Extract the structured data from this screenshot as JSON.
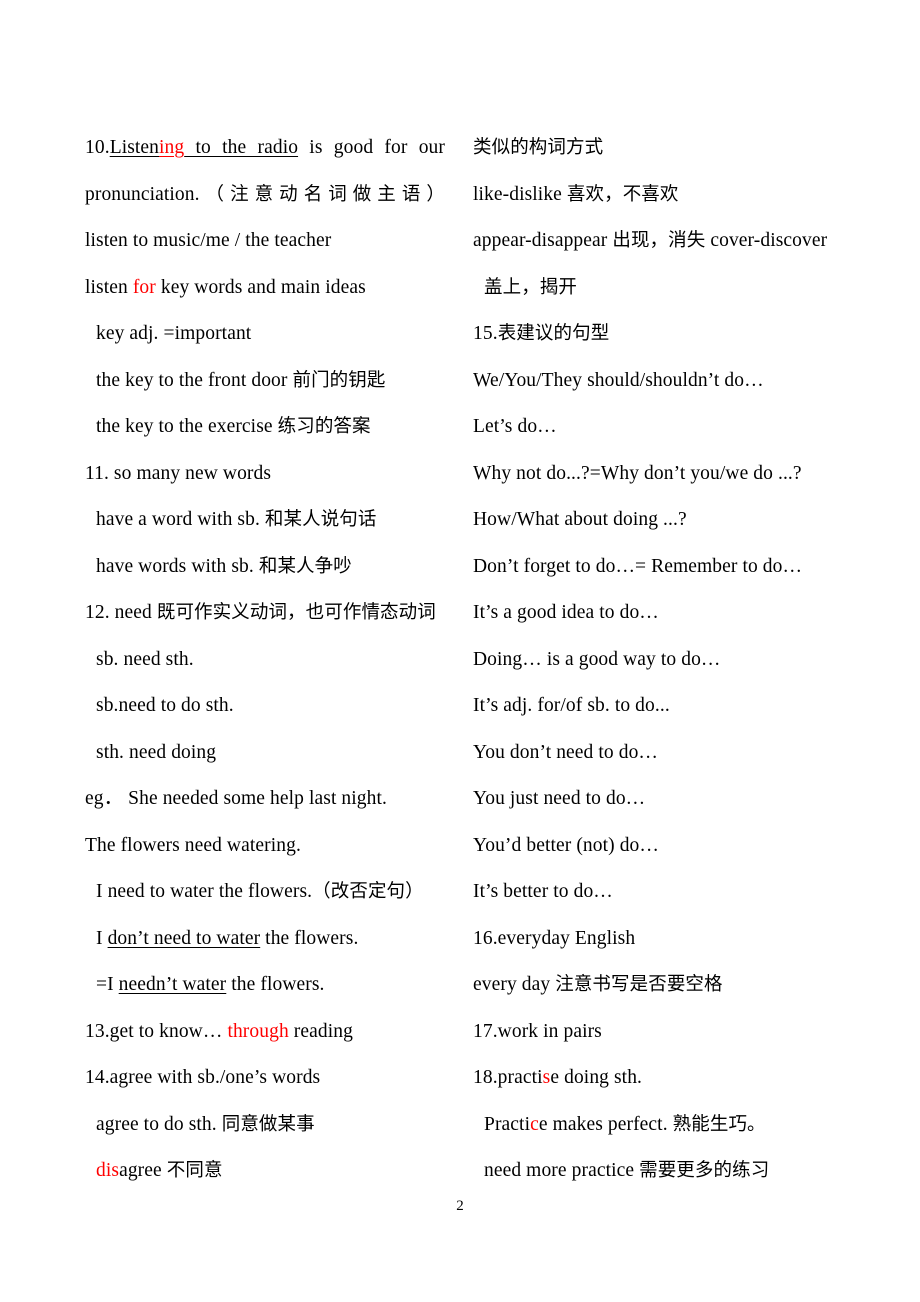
{
  "document": {
    "page_number": "2",
    "accent_color": "#ff0000",
    "text_color": "#000000",
    "background_color": "#ffffff"
  },
  "left_column": {
    "lines": [
      {
        "id": "l1",
        "justified": true,
        "segments": [
          {
            "text": "10.",
            "style": "plain"
          },
          {
            "text": "Listen",
            "style": "underline"
          },
          {
            "text": "ing",
            "style": "underline-red"
          },
          {
            "text": " to the radio",
            "style": "underline"
          },
          {
            "text": " is good for our",
            "style": "plain"
          }
        ],
        "plain_text": "10.Listening to the radio is good for our"
      },
      {
        "id": "l2",
        "justified": true,
        "segments": [
          {
            "text": "pronunciation.",
            "style": "plain"
          },
          {
            "text": "（注意动名词做主语）",
            "style": "cjk"
          }
        ],
        "plain_text": "pronunciation. （注意动名词做主语）"
      },
      {
        "id": "l3",
        "indent": 0,
        "segments": [
          {
            "text": "listen to music/me / the teacher",
            "style": "plain"
          }
        ],
        "plain_text": "listen to music/me / the teacher"
      },
      {
        "id": "l4",
        "indent": 0,
        "segments": [
          {
            "text": "listen ",
            "style": "plain"
          },
          {
            "text": "for",
            "style": "red"
          },
          {
            "text": " key words and main ideas",
            "style": "plain"
          }
        ],
        "plain_text": "listen for key words and main ideas"
      },
      {
        "id": "l5",
        "indent": 1,
        "segments": [
          {
            "text": "key adj.   =important",
            "style": "plain"
          }
        ],
        "plain_text": "key adj.   =important"
      },
      {
        "id": "l6",
        "indent": 1,
        "segments": [
          {
            "text": "the key to the front door ",
            "style": "plain"
          },
          {
            "text": "前门的钥匙",
            "style": "cjk"
          }
        ],
        "plain_text": "the key to the front door 前门的钥匙"
      },
      {
        "id": "l7",
        "indent": 1,
        "segments": [
          {
            "text": "the key to the exercise ",
            "style": "plain"
          },
          {
            "text": "练习的答案",
            "style": "cjk"
          }
        ],
        "plain_text": "the key to the exercise 练习的答案"
      },
      {
        "id": "l8",
        "indent": 0,
        "segments": [
          {
            "text": "11. so many new words",
            "style": "plain"
          }
        ],
        "plain_text": "11. so many new words"
      },
      {
        "id": "l9",
        "indent": 1,
        "segments": [
          {
            "text": "have a word with sb. ",
            "style": "plain"
          },
          {
            "text": "和某人说句话",
            "style": "cjk"
          }
        ],
        "plain_text": "have a word with sb. 和某人说句话"
      },
      {
        "id": "l10",
        "indent": 1,
        "segments": [
          {
            "text": "have words with sb. ",
            "style": "plain"
          },
          {
            "text": "和某人争吵",
            "style": "cjk"
          }
        ],
        "plain_text": "have words with sb. 和某人争吵"
      },
      {
        "id": "l11",
        "indent": 0,
        "segments": [
          {
            "text": "12. need ",
            "style": "plain"
          },
          {
            "text": "既可作实义动词，也可作情态动词",
            "style": "cjk"
          }
        ],
        "plain_text": "12. need 既可作实义动词，也可作情态动词"
      },
      {
        "id": "l12",
        "indent": 1,
        "segments": [
          {
            "text": "sb. need sth.",
            "style": "plain"
          }
        ],
        "plain_text": "sb. need sth."
      },
      {
        "id": "l13",
        "indent": 1,
        "segments": [
          {
            "text": "sb.need to do sth.",
            "style": "plain"
          }
        ],
        "plain_text": "sb.need to do sth."
      },
      {
        "id": "l14",
        "indent": 1,
        "segments": [
          {
            "text": "sth. need doing",
            "style": "plain"
          }
        ],
        "plain_text": "sth. need doing"
      },
      {
        "id": "l15",
        "indent": 0,
        "segments": [
          {
            "text": "eg．  She needed some help last night.",
            "style": "plain"
          }
        ],
        "plain_text": "eg．  She needed some help last night."
      },
      {
        "id": "l16",
        "indent": 0,
        "segments": [
          {
            "text": "The flowers need watering.",
            "style": "plain"
          }
        ],
        "plain_text": "The flowers need watering."
      },
      {
        "id": "l17",
        "indent": 1,
        "segments": [
          {
            "text": "I need to water the flowers.",
            "style": "plain"
          },
          {
            "text": "（改否定句）",
            "style": "cjk"
          }
        ],
        "plain_text": "I need to water the flowers.（改否定句）"
      },
      {
        "id": "l18",
        "indent": 1,
        "segments": [
          {
            "text": "I ",
            "style": "plain"
          },
          {
            "text": "don’t need to water",
            "style": "underline"
          },
          {
            "text": " the flowers.",
            "style": "plain"
          }
        ],
        "plain_text": "I don’t need to water the flowers."
      },
      {
        "id": "l19",
        "indent": 1,
        "segments": [
          {
            "text": "=I ",
            "style": "plain"
          },
          {
            "text": "needn’t water",
            "style": "underline"
          },
          {
            "text": " the flowers.",
            "style": "plain"
          }
        ],
        "plain_text": "=I needn’t water the flowers."
      },
      {
        "id": "l20",
        "indent": 0,
        "segments": [
          {
            "text": "13.get to know… ",
            "style": "plain"
          },
          {
            "text": "through",
            "style": "red"
          },
          {
            "text": " reading",
            "style": "plain"
          }
        ],
        "plain_text": "13.get to know… through reading"
      },
      {
        "id": "l21",
        "indent": 0,
        "segments": [
          {
            "text": "14.agree with sb./one’s words",
            "style": "plain"
          }
        ],
        "plain_text": "14.agree with sb./one’s words"
      },
      {
        "id": "l22",
        "indent": 1,
        "segments": [
          {
            "text": "agree to do sth. ",
            "style": "plain"
          },
          {
            "text": "同意做某事",
            "style": "cjk"
          }
        ],
        "plain_text": "agree to do sth. 同意做某事"
      },
      {
        "id": "l23",
        "indent": 1,
        "segments": [
          {
            "text": "dis",
            "style": "red"
          },
          {
            "text": "agree ",
            "style": "plain"
          },
          {
            "text": "不同意",
            "style": "cjk"
          }
        ],
        "plain_text": "disagree 不同意"
      }
    ]
  },
  "right_column": {
    "lines": [
      {
        "id": "r1",
        "indent": 0,
        "segments": [
          {
            "text": "类似的构词方式",
            "style": "cjk"
          }
        ],
        "plain_text": "类似的构词方式"
      },
      {
        "id": "r2",
        "indent": 0,
        "segments": [
          {
            "text": "like-dislike  ",
            "style": "plain"
          },
          {
            "text": "喜欢，不喜欢",
            "style": "cjk"
          }
        ],
        "plain_text": "like-dislike 喜欢，不喜欢"
      },
      {
        "id": "r3",
        "indent": 0,
        "segments": [
          {
            "text": "appear-disappear ",
            "style": "plain"
          },
          {
            "text": "出现，消失",
            "style": "cjk"
          },
          {
            "text": "  cover-discover",
            "style": "plain"
          }
        ],
        "plain_text": "appear-disappear 出现，消失  cover-discover"
      },
      {
        "id": "r4",
        "indent": 1,
        "segments": [
          {
            "text": "盖上，揭开",
            "style": "cjk"
          }
        ],
        "plain_text": "盖上，揭开"
      },
      {
        "id": "r5",
        "indent": 0,
        "segments": [
          {
            "text": "15.",
            "style": "plain"
          },
          {
            "text": "表建议的句型",
            "style": "cjk"
          }
        ],
        "plain_text": "15.表建议的句型"
      },
      {
        "id": "r6",
        "indent": 0,
        "segments": [
          {
            "text": "We/You/They should/shouldn’t do…",
            "style": "plain"
          }
        ],
        "plain_text": "We/You/They should/shouldn’t do…"
      },
      {
        "id": "r7",
        "indent": 0,
        "segments": [
          {
            "text": "Let’s do…",
            "style": "plain"
          }
        ],
        "plain_text": "Let’s do…"
      },
      {
        "id": "r8",
        "indent": 0,
        "segments": [
          {
            "text": "Why not do...?=Why don’t you/we do ...?",
            "style": "plain"
          }
        ],
        "plain_text": "Why not do...?=Why don’t you/we do ...?"
      },
      {
        "id": "r9",
        "indent": 0,
        "segments": [
          {
            "text": "How/What about doing ...?",
            "style": "plain"
          }
        ],
        "plain_text": "How/What about doing ...?"
      },
      {
        "id": "r10",
        "indent": 0,
        "segments": [
          {
            "text": "Don’t forget to do…= Remember to do…",
            "style": "plain"
          }
        ],
        "plain_text": "Don’t forget to do…= Remember to do…"
      },
      {
        "id": "r11",
        "indent": 0,
        "segments": [
          {
            "text": "It’s a good idea to do…",
            "style": "plain"
          }
        ],
        "plain_text": "It’s a good idea to do…"
      },
      {
        "id": "r12",
        "indent": 0,
        "segments": [
          {
            "text": "Doing… is a good way to do…",
            "style": "plain"
          }
        ],
        "plain_text": "Doing… is a good way to do…"
      },
      {
        "id": "r13",
        "indent": 0,
        "segments": [
          {
            "text": "It’s adj. for/of sb. to do...",
            "style": "plain"
          }
        ],
        "plain_text": "It’s adj. for/of sb. to do..."
      },
      {
        "id": "r14",
        "indent": 0,
        "segments": [
          {
            "text": "You don’t need to do…",
            "style": "plain"
          }
        ],
        "plain_text": "You don’t need to do…"
      },
      {
        "id": "r15",
        "indent": 0,
        "segments": [
          {
            "text": "You just need to do…",
            "style": "plain"
          }
        ],
        "plain_text": "You just need to do…"
      },
      {
        "id": "r16",
        "indent": 0,
        "segments": [
          {
            "text": "You’d better (not) do…",
            "style": "plain"
          }
        ],
        "plain_text": "You’d better (not) do…"
      },
      {
        "id": "r17",
        "indent": 0,
        "segments": [
          {
            "text": "It’s better to do…",
            "style": "plain"
          }
        ],
        "plain_text": "It’s better to do…"
      },
      {
        "id": "r18",
        "indent": 0,
        "segments": [
          {
            "text": "16.everyday English",
            "style": "plain"
          }
        ],
        "plain_text": "16.everyday English"
      },
      {
        "id": "r19",
        "indent": 0,
        "segments": [
          {
            "text": "every day ",
            "style": "plain"
          },
          {
            "text": "注意书写是否要空格",
            "style": "cjk"
          }
        ],
        "plain_text": "every day 注意书写是否要空格"
      },
      {
        "id": "r20",
        "indent": 0,
        "segments": [
          {
            "text": "17.work in pairs",
            "style": "plain"
          }
        ],
        "plain_text": "17.work in pairs"
      },
      {
        "id": "r21",
        "indent": 0,
        "segments": [
          {
            "text": "18.practi",
            "style": "plain"
          },
          {
            "text": "s",
            "style": "red"
          },
          {
            "text": "e doing sth.",
            "style": "plain"
          }
        ],
        "plain_text": "18.practise doing sth."
      },
      {
        "id": "r22",
        "indent": 1,
        "segments": [
          {
            "text": "Practi",
            "style": "plain"
          },
          {
            "text": "c",
            "style": "red"
          },
          {
            "text": "e makes perfect. ",
            "style": "plain"
          },
          {
            "text": "熟能生巧。",
            "style": "cjk"
          }
        ],
        "plain_text": "Practice makes perfect. 熟能生巧。"
      },
      {
        "id": "r23",
        "indent": 1,
        "segments": [
          {
            "text": "need more practice ",
            "style": "plain"
          },
          {
            "text": "需要更多的练习",
            "style": "cjk"
          }
        ],
        "plain_text": "need more practice 需要更多的练习"
      }
    ]
  }
}
